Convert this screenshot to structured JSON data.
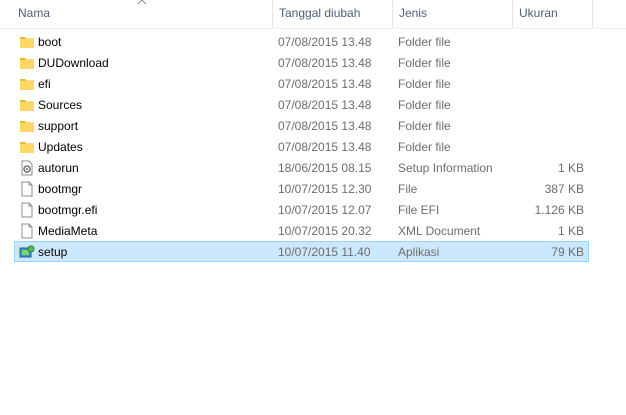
{
  "columns": {
    "name": "Nama",
    "date": "Tanggal diubah",
    "type": "Jenis",
    "size": "Ukuran"
  },
  "files": [
    {
      "name": "boot",
      "date": "07/08/2015 13.48",
      "type": "Folder file",
      "size": "",
      "icon": "folder-icon"
    },
    {
      "name": "DUDownload",
      "date": "07/08/2015 13.48",
      "type": "Folder file",
      "size": "",
      "icon": "folder-icon"
    },
    {
      "name": "efi",
      "date": "07/08/2015 13.48",
      "type": "Folder file",
      "size": "",
      "icon": "folder-icon"
    },
    {
      "name": "Sources",
      "date": "07/08/2015 13.48",
      "type": "Folder file",
      "size": "",
      "icon": "folder-icon"
    },
    {
      "name": "support",
      "date": "07/08/2015 13.48",
      "type": "Folder file",
      "size": "",
      "icon": "folder-icon"
    },
    {
      "name": "Updates",
      "date": "07/08/2015 13.48",
      "type": "Folder file",
      "size": "",
      "icon": "folder-icon"
    },
    {
      "name": "autorun",
      "date": "18/06/2015 08.15",
      "type": "Setup Information",
      "size": "1 KB",
      "icon": "settings-file-icon"
    },
    {
      "name": "bootmgr",
      "date": "10/07/2015 12.30",
      "type": "File",
      "size": "387 KB",
      "icon": "file-icon"
    },
    {
      "name": "bootmgr.efi",
      "date": "10/07/2015 12.07",
      "type": "File EFI",
      "size": "1.126 KB",
      "icon": "file-icon"
    },
    {
      "name": "MediaMeta",
      "date": "10/07/2015 20.32",
      "type": "XML Document",
      "size": "1 KB",
      "icon": "file-icon"
    },
    {
      "name": "setup",
      "date": "10/07/2015 11.40",
      "type": "Aplikasi",
      "size": "79 KB",
      "icon": "setup-app-icon",
      "selected": true
    }
  ],
  "colors": {
    "selection_bg": "#cce8ff",
    "selection_border": "#99d1ff",
    "folder": "#ffd766",
    "header_text": "#4c607a"
  }
}
